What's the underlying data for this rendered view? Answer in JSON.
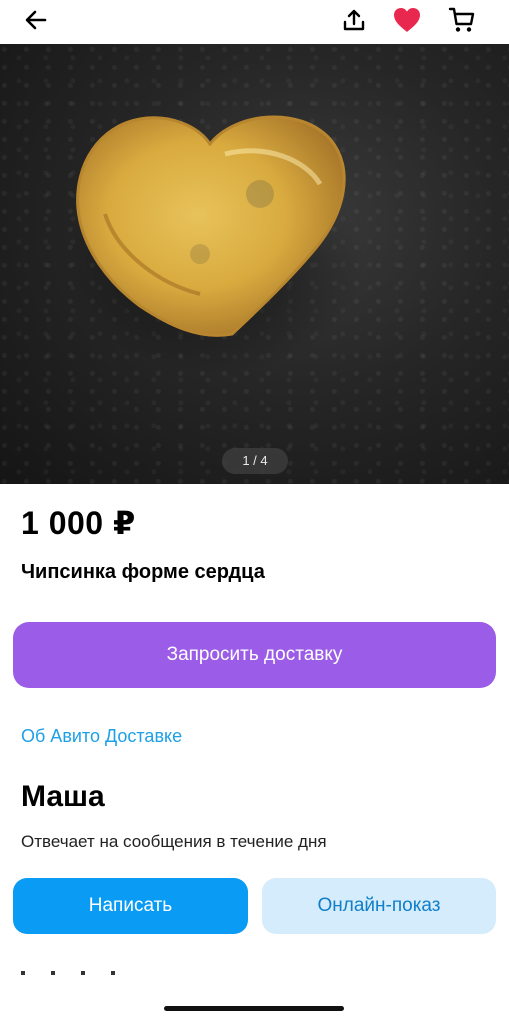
{
  "topbar": {
    "back_icon": "arrow-left-icon",
    "share_icon": "share-upload-icon",
    "favorite_icon": "heart-filled-icon",
    "cart_icon": "cart-icon",
    "favorite_color": "#e8284e"
  },
  "gallery": {
    "counter": "1 / 4"
  },
  "listing": {
    "price": "1 000 ₽",
    "title": "Чипсинка форме сердца"
  },
  "actions": {
    "delivery_button": "Запросить доставку",
    "delivery_link": "Об Авито Доставке",
    "delivery_button_color": "#9b5de7",
    "link_color": "#1ea0e6"
  },
  "seller": {
    "name": "Маша",
    "reply_time": "Отвечает на сообщения в течение дня",
    "write_button": "Написать",
    "online_button": "Онлайн-показ",
    "write_color": "#0a9cf4",
    "online_bg": "#d4ecfb"
  }
}
